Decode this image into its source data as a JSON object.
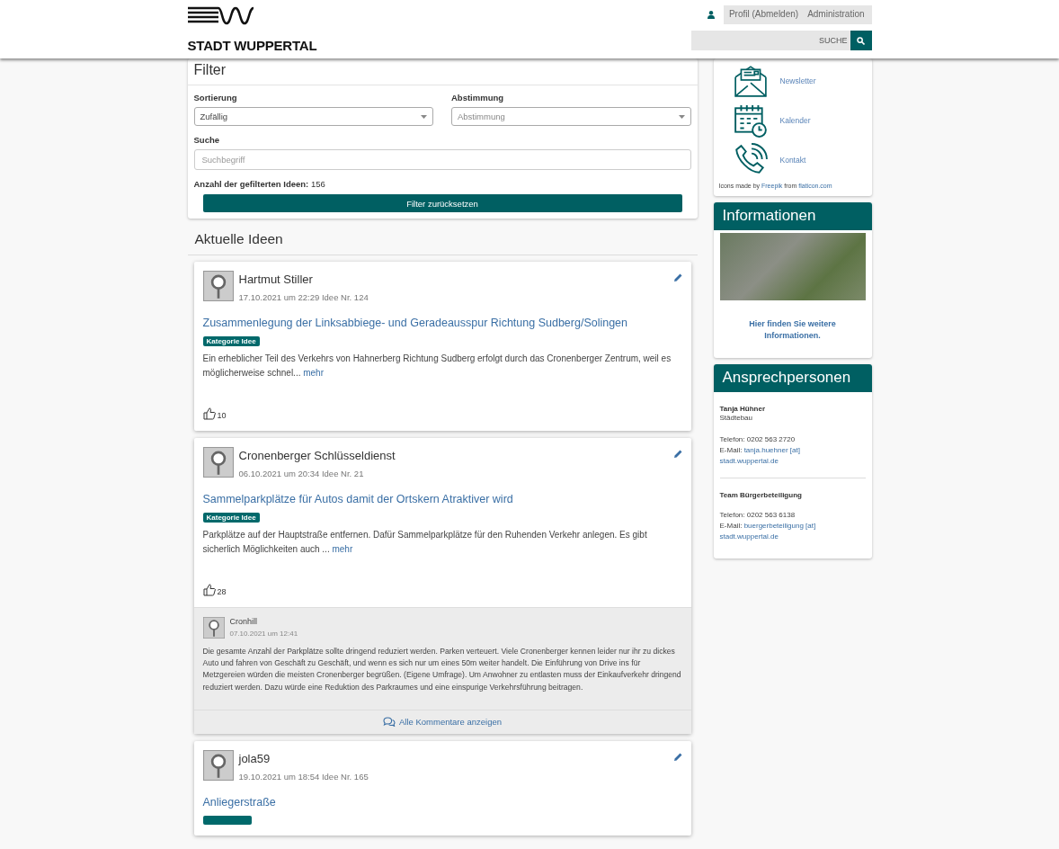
{
  "header": {
    "logo_text": "STADT WUPPERTAL",
    "nav": [
      "Profil (Abmelden)",
      "Administration"
    ],
    "search_button": "SUCHE"
  },
  "filter": {
    "title": "Filter",
    "sort_label": "Sortierung",
    "sort_value": "Zufällig",
    "vote_label": "Abstimmung",
    "vote_placeholder": "Abstimmung",
    "search_label": "Suche",
    "search_placeholder": "Suchbegriff",
    "count_label": "Anzahl der gefilterten Ideen:",
    "count_value": "156",
    "reset_button": "Filter zurücksetzen"
  },
  "ideas_heading": "Aktuelle Ideen",
  "ideas": [
    {
      "author": "Hartmut Stiller",
      "meta": "17.10.2021 um 22:29 Idee Nr. 124",
      "title": "Zusammenlegung der Linksabbiege- und Geradeausspur Richtung Sudberg/Solingen",
      "category": "Kategorie Idee",
      "text": "Ein erheblicher Teil des Verkehrs von Hahnerberg Richtung Sudberg erfolgt durch das Cronenberger Zentrum, weil es möglicherweise schnel...",
      "more": "mehr",
      "likes": "10"
    },
    {
      "author": "Cronenberger Schlüsseldienst",
      "meta": "06.10.2021 um 20:34 Idee Nr. 21",
      "title": "Sammelparkplätze für Autos damit der Ortskern Atraktiver wird",
      "category": "Kategorie Idee",
      "text": "Parkplätze auf der Hauptstraße entfernen. Dafür Sammelparkplätze für den Ruhenden Verkehr anlegen. Es gibt sicherlich Möglichkeiten auch ...",
      "more": "mehr",
      "likes": "28",
      "comments": [
        {
          "author": "Cronhill",
          "date": "07.10.2021 um 12:41",
          "text": "Die gesamte Anzahl der Parkplätze sollte dringend reduziert werden. Parken verteuert. Viele Cronenberger kennen leider nur ihr zu dickes Auto und fahren von Geschäft zu Geschäft, und wenn es sich nur um eines 50m weiter handelt. Die Einführung von Drive ins für Metzgereien würden die meisten Cronenberger begrüßen. (Eigene Umfrage). Um Anwohner zu entlasten muss der Einkaufverkehr dringend reduziert werden. Dazu würde eine Reduktion des Parkraumes und eine einspurige Verkehrsführung beitragen."
        }
      ],
      "all_comments": "Alle Kommentare anzeigen"
    },
    {
      "author": "jola59",
      "meta": "19.10.2021 um 18:54 Idee Nr. 165",
      "title": "Anliegerstraße"
    }
  ],
  "sidebar": {
    "links": [
      {
        "kind": "newsletter",
        "label": "Newsletter"
      },
      {
        "kind": "calendar",
        "label": "Kalender"
      },
      {
        "kind": "phone",
        "label": "Kontakt"
      }
    ],
    "credit": {
      "prefix": "Icons made by",
      "author": "Freepik",
      "middle": "from",
      "site": "flaticon.com"
    },
    "info": {
      "title": "Informationen",
      "link": "Hier finden Sie weitere Informationen."
    },
    "contacts": {
      "title": "Ansprechpersonen",
      "persons": [
        {
          "name": "Tanja Hühner",
          "department": "Städtebau",
          "phone": "Telefon: 0202 563 2720",
          "email_label": "E-Mail:",
          "email": [
            "tanja.huehner [at]",
            "stadt.wuppertal.de"
          ]
        },
        {
          "name": "Team Bürgerbeteiligung",
          "phone": "Telefon: 0202 563 6138",
          "email_label": "E-Mail:",
          "email": [
            "buergerbeteiligung [at]",
            "stadt.wuppertal.de"
          ]
        }
      ]
    }
  }
}
